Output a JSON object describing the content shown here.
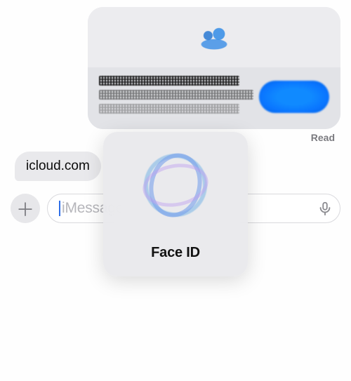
{
  "messages": {
    "incoming_text": "icloud.com",
    "outgoing_status": "Read",
    "link_preview": {
      "icon": "people-icon",
      "title_redacted": true,
      "subtitle_redacted": true,
      "action_label_redacted": true
    }
  },
  "compose": {
    "placeholder": "iMessage",
    "add_icon": "plus-icon",
    "mic_icon": "microphone-icon"
  },
  "modal": {
    "title": "Face ID",
    "icon": "face-id-scan-icon"
  }
}
